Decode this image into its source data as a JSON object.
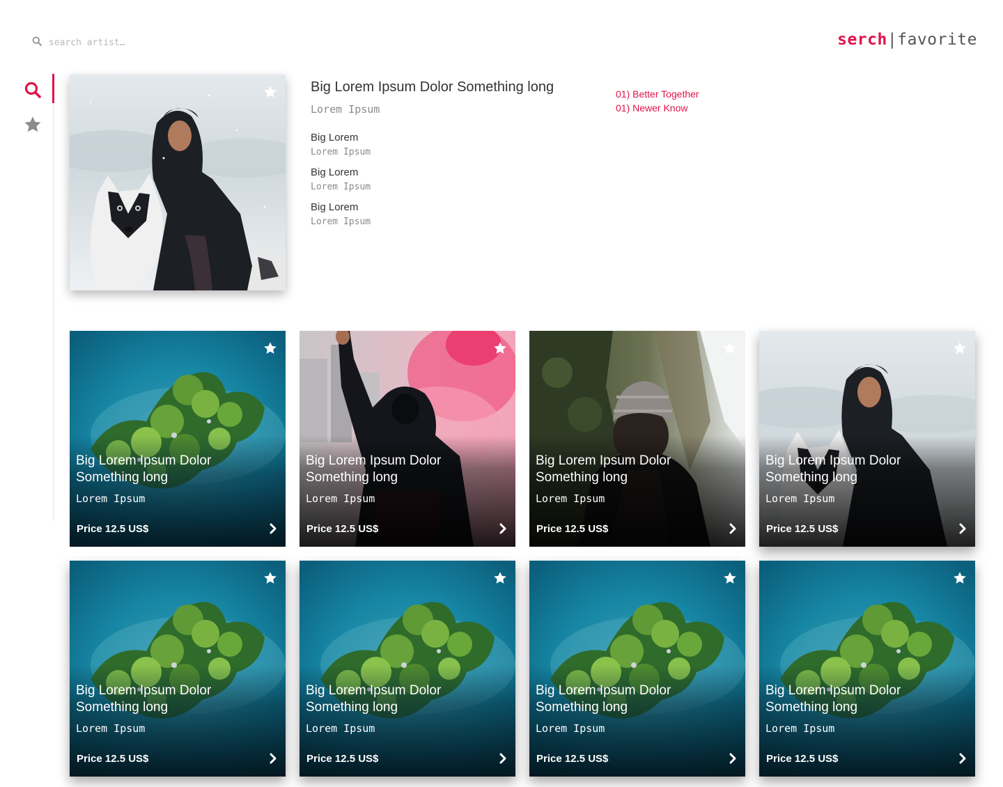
{
  "header": {
    "search_placeholder": "search artist…",
    "brand_part1": "serch",
    "brand_separator": "|",
    "brand_part2": "favorite"
  },
  "sidebar": {
    "items": [
      {
        "icon": "search-icon",
        "active": true
      },
      {
        "icon": "star-icon",
        "active": false
      }
    ]
  },
  "detail": {
    "title": "Big Lorem Ipsum Dolor Something long",
    "subtitle": "Lorem Ipsum",
    "info": [
      {
        "big": "Big Lorem",
        "small": "Lorem Ipsum"
      },
      {
        "big": "Big Lorem",
        "small": "Lorem Ipsum"
      },
      {
        "big": "Big Lorem",
        "small": "Lorem Ipsum"
      }
    ],
    "tracks": [
      "01) Better Together",
      "01) Newer Know"
    ]
  },
  "cards": [
    {
      "title": "Big Lorem Ipsum Dolor Something long",
      "subtitle": "Lorem Ipsum",
      "price": "Price 12.5 US$",
      "image": "island-aerial"
    },
    {
      "title": "Big Lorem Ipsum Dolor Something long",
      "subtitle": "Lorem Ipsum",
      "price": "Price 12.5 US$",
      "image": "hooded-person-pink-smoke"
    },
    {
      "title": "Big Lorem Ipsum Dolor Something long",
      "subtitle": "Lorem Ipsum",
      "price": "Price 12.5 US$",
      "image": "person-beanie-forest"
    },
    {
      "title": "Big Lorem Ipsum Dolor Something long",
      "subtitle": "Lorem Ipsum",
      "price": "Price 12.5 US$",
      "image": "woman-with-husky"
    },
    {
      "title": "Big Lorem Ipsum Dolor Something long",
      "subtitle": "Lorem Ipsum",
      "price": "Price 12.5 US$",
      "image": "island-aerial"
    },
    {
      "title": "Big Lorem Ipsum Dolor Something long",
      "subtitle": "Lorem Ipsum",
      "price": "Price 12.5 US$",
      "image": "island-aerial"
    },
    {
      "title": "Big Lorem Ipsum Dolor Something long",
      "subtitle": "Lorem Ipsum",
      "price": "Price 12.5 US$",
      "image": "island-aerial"
    },
    {
      "title": "Big Lorem Ipsum Dolor Something long",
      "subtitle": "Lorem Ipsum",
      "price": "Price 12.5 US$",
      "image": "island-aerial"
    }
  ],
  "colors": {
    "accent": "#e0134a",
    "icon_gray": "#8c8c8c",
    "text_gray": "#8a8a8a"
  }
}
